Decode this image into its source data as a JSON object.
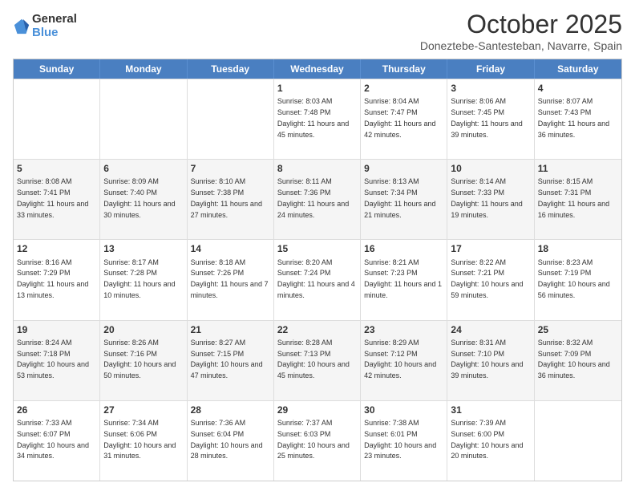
{
  "logo": {
    "general": "General",
    "blue": "Blue"
  },
  "header": {
    "month": "October 2025",
    "location": "Doneztebe-Santesteban, Navarre, Spain"
  },
  "weekdays": [
    "Sunday",
    "Monday",
    "Tuesday",
    "Wednesday",
    "Thursday",
    "Friday",
    "Saturday"
  ],
  "rows": [
    [
      {
        "day": "",
        "sun": "",
        "mon": "",
        "sunrise": "",
        "sunset": "",
        "daylight": ""
      },
      {
        "day": "",
        "content": ""
      },
      {
        "day": "",
        "content": ""
      },
      {
        "day": "1",
        "sunrise": "Sunrise: 8:03 AM",
        "sunset": "Sunset: 7:48 PM",
        "daylight": "Daylight: 11 hours and 45 minutes."
      },
      {
        "day": "2",
        "sunrise": "Sunrise: 8:04 AM",
        "sunset": "Sunset: 7:47 PM",
        "daylight": "Daylight: 11 hours and 42 minutes."
      },
      {
        "day": "3",
        "sunrise": "Sunrise: 8:06 AM",
        "sunset": "Sunset: 7:45 PM",
        "daylight": "Daylight: 11 hours and 39 minutes."
      },
      {
        "day": "4",
        "sunrise": "Sunrise: 8:07 AM",
        "sunset": "Sunset: 7:43 PM",
        "daylight": "Daylight: 11 hours and 36 minutes."
      }
    ],
    [
      {
        "day": "5",
        "sunrise": "Sunrise: 8:08 AM",
        "sunset": "Sunset: 7:41 PM",
        "daylight": "Daylight: 11 hours and 33 minutes."
      },
      {
        "day": "6",
        "sunrise": "Sunrise: 8:09 AM",
        "sunset": "Sunset: 7:40 PM",
        "daylight": "Daylight: 11 hours and 30 minutes."
      },
      {
        "day": "7",
        "sunrise": "Sunrise: 8:10 AM",
        "sunset": "Sunset: 7:38 PM",
        "daylight": "Daylight: 11 hours and 27 minutes."
      },
      {
        "day": "8",
        "sunrise": "Sunrise: 8:11 AM",
        "sunset": "Sunset: 7:36 PM",
        "daylight": "Daylight: 11 hours and 24 minutes."
      },
      {
        "day": "9",
        "sunrise": "Sunrise: 8:13 AM",
        "sunset": "Sunset: 7:34 PM",
        "daylight": "Daylight: 11 hours and 21 minutes."
      },
      {
        "day": "10",
        "sunrise": "Sunrise: 8:14 AM",
        "sunset": "Sunset: 7:33 PM",
        "daylight": "Daylight: 11 hours and 19 minutes."
      },
      {
        "day": "11",
        "sunrise": "Sunrise: 8:15 AM",
        "sunset": "Sunset: 7:31 PM",
        "daylight": "Daylight: 11 hours and 16 minutes."
      }
    ],
    [
      {
        "day": "12",
        "sunrise": "Sunrise: 8:16 AM",
        "sunset": "Sunset: 7:29 PM",
        "daylight": "Daylight: 11 hours and 13 minutes."
      },
      {
        "day": "13",
        "sunrise": "Sunrise: 8:17 AM",
        "sunset": "Sunset: 7:28 PM",
        "daylight": "Daylight: 11 hours and 10 minutes."
      },
      {
        "day": "14",
        "sunrise": "Sunrise: 8:18 AM",
        "sunset": "Sunset: 7:26 PM",
        "daylight": "Daylight: 11 hours and 7 minutes."
      },
      {
        "day": "15",
        "sunrise": "Sunrise: 8:20 AM",
        "sunset": "Sunset: 7:24 PM",
        "daylight": "Daylight: 11 hours and 4 minutes."
      },
      {
        "day": "16",
        "sunrise": "Sunrise: 8:21 AM",
        "sunset": "Sunset: 7:23 PM",
        "daylight": "Daylight: 11 hours and 1 minute."
      },
      {
        "day": "17",
        "sunrise": "Sunrise: 8:22 AM",
        "sunset": "Sunset: 7:21 PM",
        "daylight": "Daylight: 10 hours and 59 minutes."
      },
      {
        "day": "18",
        "sunrise": "Sunrise: 8:23 AM",
        "sunset": "Sunset: 7:19 PM",
        "daylight": "Daylight: 10 hours and 56 minutes."
      }
    ],
    [
      {
        "day": "19",
        "sunrise": "Sunrise: 8:24 AM",
        "sunset": "Sunset: 7:18 PM",
        "daylight": "Daylight: 10 hours and 53 minutes."
      },
      {
        "day": "20",
        "sunrise": "Sunrise: 8:26 AM",
        "sunset": "Sunset: 7:16 PM",
        "daylight": "Daylight: 10 hours and 50 minutes."
      },
      {
        "day": "21",
        "sunrise": "Sunrise: 8:27 AM",
        "sunset": "Sunset: 7:15 PM",
        "daylight": "Daylight: 10 hours and 47 minutes."
      },
      {
        "day": "22",
        "sunrise": "Sunrise: 8:28 AM",
        "sunset": "Sunset: 7:13 PM",
        "daylight": "Daylight: 10 hours and 45 minutes."
      },
      {
        "day": "23",
        "sunrise": "Sunrise: 8:29 AM",
        "sunset": "Sunset: 7:12 PM",
        "daylight": "Daylight: 10 hours and 42 minutes."
      },
      {
        "day": "24",
        "sunrise": "Sunrise: 8:31 AM",
        "sunset": "Sunset: 7:10 PM",
        "daylight": "Daylight: 10 hours and 39 minutes."
      },
      {
        "day": "25",
        "sunrise": "Sunrise: 8:32 AM",
        "sunset": "Sunset: 7:09 PM",
        "daylight": "Daylight: 10 hours and 36 minutes."
      }
    ],
    [
      {
        "day": "26",
        "sunrise": "Sunrise: 7:33 AM",
        "sunset": "Sunset: 6:07 PM",
        "daylight": "Daylight: 10 hours and 34 minutes."
      },
      {
        "day": "27",
        "sunrise": "Sunrise: 7:34 AM",
        "sunset": "Sunset: 6:06 PM",
        "daylight": "Daylight: 10 hours and 31 minutes."
      },
      {
        "day": "28",
        "sunrise": "Sunrise: 7:36 AM",
        "sunset": "Sunset: 6:04 PM",
        "daylight": "Daylight: 10 hours and 28 minutes."
      },
      {
        "day": "29",
        "sunrise": "Sunrise: 7:37 AM",
        "sunset": "Sunset: 6:03 PM",
        "daylight": "Daylight: 10 hours and 25 minutes."
      },
      {
        "day": "30",
        "sunrise": "Sunrise: 7:38 AM",
        "sunset": "Sunset: 6:01 PM",
        "daylight": "Daylight: 10 hours and 23 minutes."
      },
      {
        "day": "31",
        "sunrise": "Sunrise: 7:39 AM",
        "sunset": "Sunset: 6:00 PM",
        "daylight": "Daylight: 10 hours and 20 minutes."
      },
      {
        "day": "",
        "sunrise": "",
        "sunset": "",
        "daylight": ""
      }
    ]
  ]
}
